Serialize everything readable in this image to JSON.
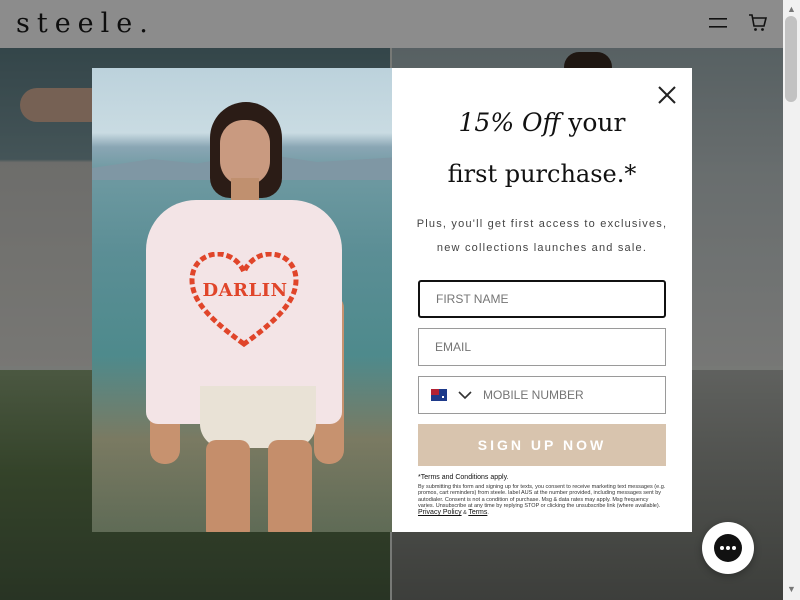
{
  "header": {
    "logo": "steele.",
    "menu_icon": "hamburger-menu-icon",
    "cart_icon": "shopping-bag-icon"
  },
  "popup": {
    "headline_italic": "15% Off",
    "headline_rest": " your",
    "headline_line2": "first purchase.*",
    "subtext_line1": "Plus, you'll get first access to exclusives,",
    "subtext_line2": "new collections launches and sale.",
    "image_shirt_text": "DARLIN",
    "first_name_placeholder": "FIRST NAME",
    "email_placeholder": "EMAIL",
    "phone_placeholder": "MOBILE NUMBER",
    "country_flag": "australia-flag-icon",
    "signup_label": "SIGN UP NOW",
    "terms_title": "*Terms and Conditions apply.",
    "terms_body": "By submitting this form and signing up for texts, you consent to receive marketing text messages (e.g. promos, cart reminders) from steele. label AUS at the number provided, including messages sent by autodialer. Consent is not a condition of purchase. Msg & data rates may apply. Msg frequency varies. Unsubscribe at any time by replying STOP or clicking the unsubscribe link (where available).",
    "privacy_link": "Privacy Policy",
    "and_text": " & ",
    "terms_link": "Terms",
    "close_icon": "close-icon"
  },
  "colors": {
    "signup_button": "#d8c4ae",
    "overlay": "rgba(0,0,0,0.45)",
    "shirt_print": "#e0452a"
  },
  "chat": {
    "icon": "chat-bubble-icon"
  }
}
